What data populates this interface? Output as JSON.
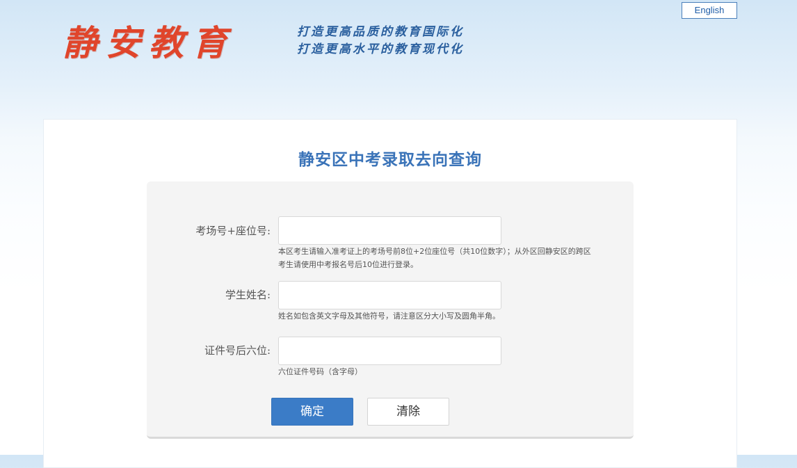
{
  "header": {
    "logo_text": "静安教育",
    "slogan_line1": "打造更高品质的教育国际化",
    "slogan_line2": "打造更高水平的教育现代化",
    "language_button": "English"
  },
  "page_title": "静安区中考录取去向查询",
  "form": {
    "fields": [
      {
        "label": "考场号+座位号:",
        "value": "",
        "hint_line1": "本区考生请输入准考证上的考场号前8位+2位座位号（共10位数字）；从外区回静安区的跨区",
        "hint_line2": "考生请使用中考报名号后10位进行登录。"
      },
      {
        "label": "学生姓名:",
        "value": "",
        "hint_line1": "姓名如包含英文字母及其他符号，请注意区分大小写及圆角半角。"
      },
      {
        "label": "证件号后六位:",
        "value": "",
        "hint_line1": "六位证件号码（含字母）"
      }
    ],
    "submit_label": "确定",
    "clear_label": "清除"
  },
  "colors": {
    "logo": "#e0452b",
    "slogan": "#2a5f9e",
    "title": "#3a73b8",
    "primary_button": "#3b7cc7"
  }
}
